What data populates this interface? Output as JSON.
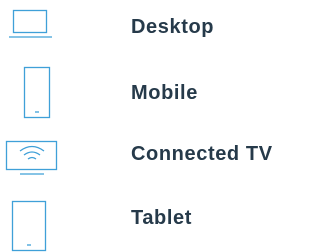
{
  "colors": {
    "text": "#263a4a",
    "icon": "#3fa0d8"
  },
  "devices": [
    {
      "label": "Desktop",
      "icon": "desktop-icon"
    },
    {
      "label": "Mobile",
      "icon": "mobile-icon"
    },
    {
      "label": "Connected TV",
      "icon": "connected-tv-icon"
    },
    {
      "label": "Tablet",
      "icon": "tablet-icon"
    }
  ]
}
